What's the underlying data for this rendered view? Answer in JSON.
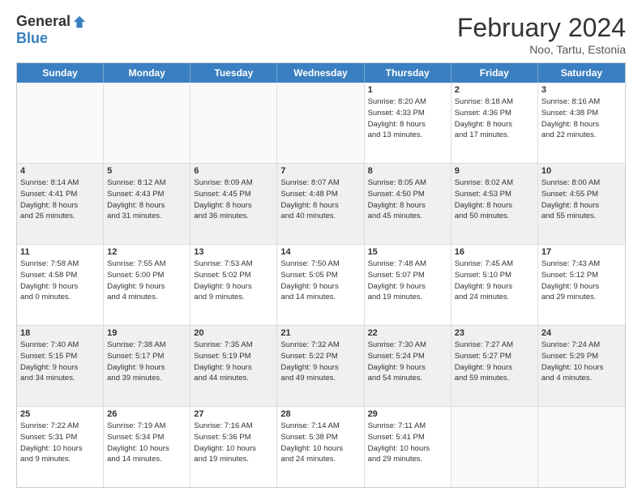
{
  "header": {
    "logo_general": "General",
    "logo_blue": "Blue",
    "title": "February 2024",
    "location": "Noo, Tartu, Estonia"
  },
  "weekdays": [
    "Sunday",
    "Monday",
    "Tuesday",
    "Wednesday",
    "Thursday",
    "Friday",
    "Saturday"
  ],
  "rows": [
    [
      {
        "day": "",
        "info": "",
        "empty": true
      },
      {
        "day": "",
        "info": "",
        "empty": true
      },
      {
        "day": "",
        "info": "",
        "empty": true
      },
      {
        "day": "",
        "info": "",
        "empty": true
      },
      {
        "day": "1",
        "info": "Sunrise: 8:20 AM\nSunset: 4:33 PM\nDaylight: 8 hours\nand 13 minutes."
      },
      {
        "day": "2",
        "info": "Sunrise: 8:18 AM\nSunset: 4:36 PM\nDaylight: 8 hours\nand 17 minutes."
      },
      {
        "day": "3",
        "info": "Sunrise: 8:16 AM\nSunset: 4:38 PM\nDaylight: 8 hours\nand 22 minutes."
      }
    ],
    [
      {
        "day": "4",
        "info": "Sunrise: 8:14 AM\nSunset: 4:41 PM\nDaylight: 8 hours\nand 26 minutes.",
        "shaded": true
      },
      {
        "day": "5",
        "info": "Sunrise: 8:12 AM\nSunset: 4:43 PM\nDaylight: 8 hours\nand 31 minutes.",
        "shaded": true
      },
      {
        "day": "6",
        "info": "Sunrise: 8:09 AM\nSunset: 4:45 PM\nDaylight: 8 hours\nand 36 minutes.",
        "shaded": true
      },
      {
        "day": "7",
        "info": "Sunrise: 8:07 AM\nSunset: 4:48 PM\nDaylight: 8 hours\nand 40 minutes.",
        "shaded": true
      },
      {
        "day": "8",
        "info": "Sunrise: 8:05 AM\nSunset: 4:50 PM\nDaylight: 8 hours\nand 45 minutes.",
        "shaded": true
      },
      {
        "day": "9",
        "info": "Sunrise: 8:02 AM\nSunset: 4:53 PM\nDaylight: 8 hours\nand 50 minutes.",
        "shaded": true
      },
      {
        "day": "10",
        "info": "Sunrise: 8:00 AM\nSunset: 4:55 PM\nDaylight: 8 hours\nand 55 minutes.",
        "shaded": true
      }
    ],
    [
      {
        "day": "11",
        "info": "Sunrise: 7:58 AM\nSunset: 4:58 PM\nDaylight: 9 hours\nand 0 minutes."
      },
      {
        "day": "12",
        "info": "Sunrise: 7:55 AM\nSunset: 5:00 PM\nDaylight: 9 hours\nand 4 minutes."
      },
      {
        "day": "13",
        "info": "Sunrise: 7:53 AM\nSunset: 5:02 PM\nDaylight: 9 hours\nand 9 minutes."
      },
      {
        "day": "14",
        "info": "Sunrise: 7:50 AM\nSunset: 5:05 PM\nDaylight: 9 hours\nand 14 minutes."
      },
      {
        "day": "15",
        "info": "Sunrise: 7:48 AM\nSunset: 5:07 PM\nDaylight: 9 hours\nand 19 minutes."
      },
      {
        "day": "16",
        "info": "Sunrise: 7:45 AM\nSunset: 5:10 PM\nDaylight: 9 hours\nand 24 minutes."
      },
      {
        "day": "17",
        "info": "Sunrise: 7:43 AM\nSunset: 5:12 PM\nDaylight: 9 hours\nand 29 minutes."
      }
    ],
    [
      {
        "day": "18",
        "info": "Sunrise: 7:40 AM\nSunset: 5:15 PM\nDaylight: 9 hours\nand 34 minutes.",
        "shaded": true
      },
      {
        "day": "19",
        "info": "Sunrise: 7:38 AM\nSunset: 5:17 PM\nDaylight: 9 hours\nand 39 minutes.",
        "shaded": true
      },
      {
        "day": "20",
        "info": "Sunrise: 7:35 AM\nSunset: 5:19 PM\nDaylight: 9 hours\nand 44 minutes.",
        "shaded": true
      },
      {
        "day": "21",
        "info": "Sunrise: 7:32 AM\nSunset: 5:22 PM\nDaylight: 9 hours\nand 49 minutes.",
        "shaded": true
      },
      {
        "day": "22",
        "info": "Sunrise: 7:30 AM\nSunset: 5:24 PM\nDaylight: 9 hours\nand 54 minutes.",
        "shaded": true
      },
      {
        "day": "23",
        "info": "Sunrise: 7:27 AM\nSunset: 5:27 PM\nDaylight: 9 hours\nand 59 minutes.",
        "shaded": true
      },
      {
        "day": "24",
        "info": "Sunrise: 7:24 AM\nSunset: 5:29 PM\nDaylight: 10 hours\nand 4 minutes.",
        "shaded": true
      }
    ],
    [
      {
        "day": "25",
        "info": "Sunrise: 7:22 AM\nSunset: 5:31 PM\nDaylight: 10 hours\nand 9 minutes."
      },
      {
        "day": "26",
        "info": "Sunrise: 7:19 AM\nSunset: 5:34 PM\nDaylight: 10 hours\nand 14 minutes."
      },
      {
        "day": "27",
        "info": "Sunrise: 7:16 AM\nSunset: 5:36 PM\nDaylight: 10 hours\nand 19 minutes."
      },
      {
        "day": "28",
        "info": "Sunrise: 7:14 AM\nSunset: 5:38 PM\nDaylight: 10 hours\nand 24 minutes."
      },
      {
        "day": "29",
        "info": "Sunrise: 7:11 AM\nSunset: 5:41 PM\nDaylight: 10 hours\nand 29 minutes."
      },
      {
        "day": "",
        "info": "",
        "empty": true
      },
      {
        "day": "",
        "info": "",
        "empty": true
      }
    ]
  ]
}
